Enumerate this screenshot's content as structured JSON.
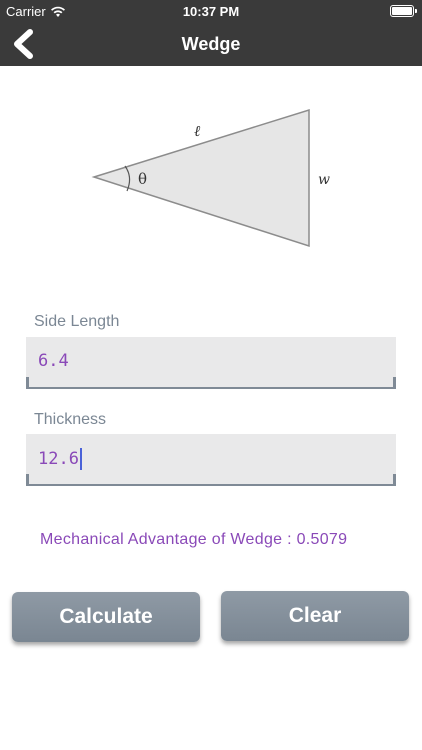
{
  "status_bar": {
    "carrier": "Carrier",
    "time": "10:37 PM"
  },
  "nav": {
    "title": "Wedge",
    "back_icon": "chevron-left-icon"
  },
  "diagram": {
    "length_label": "ℓ",
    "angle_label": "θ",
    "width_label": "w"
  },
  "fields": [
    {
      "label": "Side Length",
      "value": "6.4"
    },
    {
      "label": "Thickness",
      "value": "12.6"
    }
  ],
  "result": {
    "text": "Mechanical Advantage of Wedge : 0.5079"
  },
  "buttons": {
    "calculate": "Calculate",
    "clear": "Clear"
  },
  "colors": {
    "bar": "#3a3a3a",
    "accent": "#8a49b8",
    "button": "#7f8a96",
    "label": "#7b8794"
  }
}
